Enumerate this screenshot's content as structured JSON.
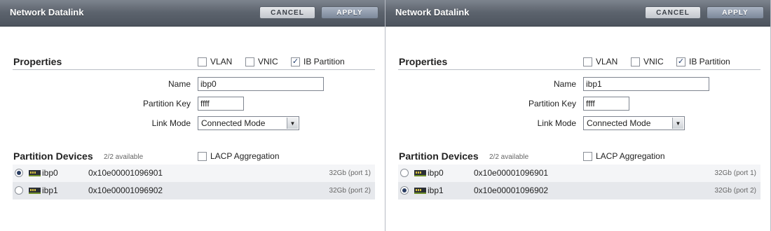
{
  "dialogs": [
    {
      "title": "Network Datalink",
      "cancel_label": "CANCEL",
      "apply_label": "APPLY",
      "properties": {
        "heading": "Properties",
        "vlan_label": "VLAN",
        "vlan_checked": false,
        "vnic_label": "VNIC",
        "vnic_checked": false,
        "ib_label": "IB Partition",
        "ib_checked": true,
        "name_label": "Name",
        "name_value": "ibp0",
        "pkey_label": "Partition Key",
        "pkey_value": "ffff",
        "mode_label": "Link Mode",
        "mode_value": "Connected Mode"
      },
      "devices": {
        "heading": "Partition Devices",
        "available": "2/2 available",
        "lacp_label": "LACP Aggregation",
        "lacp_checked": false,
        "rows": [
          {
            "name": "ibp0",
            "guid": "0x10e00001096901",
            "speed": "32Gb (port 1)",
            "selected": true
          },
          {
            "name": "ibp1",
            "guid": "0x10e00001096902",
            "speed": "32Gb (port 2)",
            "selected": false
          }
        ]
      }
    },
    {
      "title": "Network Datalink",
      "cancel_label": "CANCEL",
      "apply_label": "APPLY",
      "properties": {
        "heading": "Properties",
        "vlan_label": "VLAN",
        "vlan_checked": false,
        "vnic_label": "VNIC",
        "vnic_checked": false,
        "ib_label": "IB Partition",
        "ib_checked": true,
        "name_label": "Name",
        "name_value": "ibp1",
        "pkey_label": "Partition Key",
        "pkey_value": "ffff",
        "mode_label": "Link Mode",
        "mode_value": "Connected Mode"
      },
      "devices": {
        "heading": "Partition Devices",
        "available": "2/2 available",
        "lacp_label": "LACP Aggregation",
        "lacp_checked": false,
        "rows": [
          {
            "name": "ibp0",
            "guid": "0x10e00001096901",
            "speed": "32Gb (port 1)",
            "selected": false
          },
          {
            "name": "ibp1",
            "guid": "0x10e00001096902",
            "speed": "32Gb (port 2)",
            "selected": true
          }
        ]
      }
    }
  ]
}
